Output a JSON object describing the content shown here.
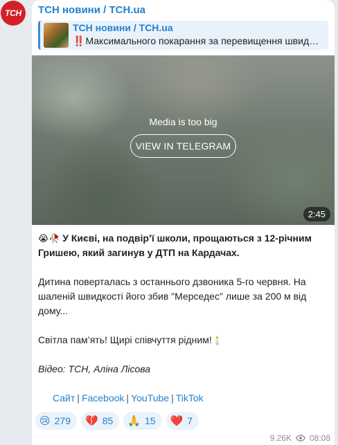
{
  "channel": {
    "name": "ТСН новини / TCH.ua",
    "avatar_text": "ТСН"
  },
  "reply": {
    "title": "ТСН новини / TCH.ua",
    "bang": "‼️",
    "text": "Максимального покарання за перевищення швид…"
  },
  "media": {
    "note": "Media is too big",
    "button": "VIEW IN TELEGRAM",
    "duration": "2:45"
  },
  "post": {
    "lead_emoji": "😭🥀",
    "lead": "У Києві, на подвір’ї школи, прощаються з 12-річним Гришею, який загинув у ДТП на Кардачах.",
    "body": "Дитина поверталась з останнього дзвоника 5-го червня. На шаленій швидкості його збив \"Мерседес\" лише за 200 м від дому...",
    "condolence": "Світла пам’ять! Щирі співчуття рідним!",
    "condolence_emoji": "🕯️",
    "credit": "Відео: ТСН, Аліна Лісова"
  },
  "links": [
    "Сайт",
    "Facebook",
    "YouTube",
    "TikTok"
  ],
  "link_separator": "|",
  "reactions": [
    {
      "icon": "😢",
      "icon_name": "crying-face-icon",
      "count": "279"
    },
    {
      "icon": "💔",
      "icon_name": "broken-heart-icon",
      "count": "85"
    },
    {
      "icon": "🙏",
      "icon_name": "folded-hands-icon",
      "count": "15"
    },
    {
      "icon": "❤️",
      "icon_name": "red-heart-icon",
      "count": "7"
    }
  ],
  "meta": {
    "views": "9.26K",
    "time": "08:08"
  },
  "colors": {
    "accent": "#2481cc",
    "avatar_bg": "#d32026",
    "background": "#e7ebf0"
  }
}
